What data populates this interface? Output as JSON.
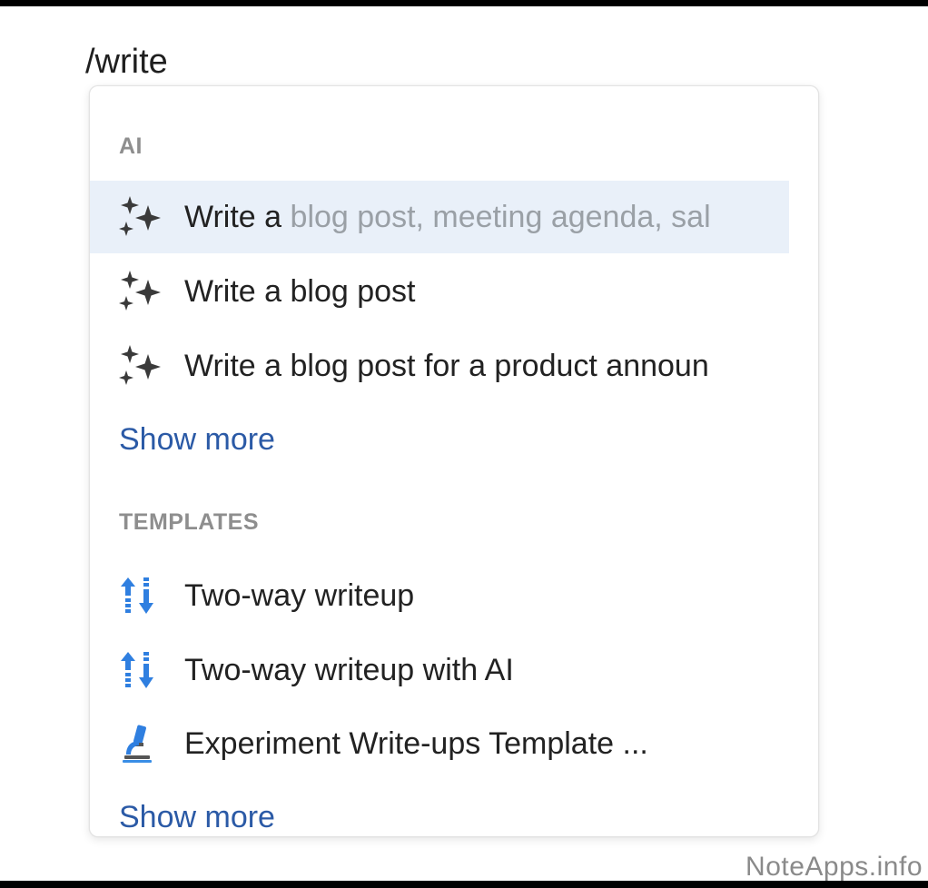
{
  "command_input": {
    "value": "/write"
  },
  "ai_section": {
    "title": "AI",
    "items": [
      {
        "prefix": "Write a",
        "suggestion": "blog post, meeting agenda, sal",
        "icon": "sparkles-icon",
        "highlighted": true
      },
      {
        "prefix": "Write a blog post",
        "suggestion": "",
        "icon": "sparkles-icon",
        "highlighted": false
      },
      {
        "prefix": "Write a blog post for a product announ",
        "suggestion": "",
        "icon": "sparkles-icon",
        "highlighted": false
      }
    ],
    "show_more": "Show more"
  },
  "templates_section": {
    "title": "TEMPLATES",
    "items": [
      {
        "label": "Two-way writeup",
        "icon": "sort-arrows-icon"
      },
      {
        "label": "Two-way writeup with AI",
        "icon": "sort-arrows-icon"
      },
      {
        "label": "Experiment Write-ups Template ...",
        "icon": "microscope-icon"
      }
    ],
    "show_more": "Show more"
  },
  "watermark": "NoteApps.info",
  "colors": {
    "highlight": "#e9f0f9",
    "link": "#2b5aa6",
    "section_title": "#8e8e8e",
    "ghost_text": "#9aa0a6",
    "icon_blue": "#2f7fe0"
  }
}
